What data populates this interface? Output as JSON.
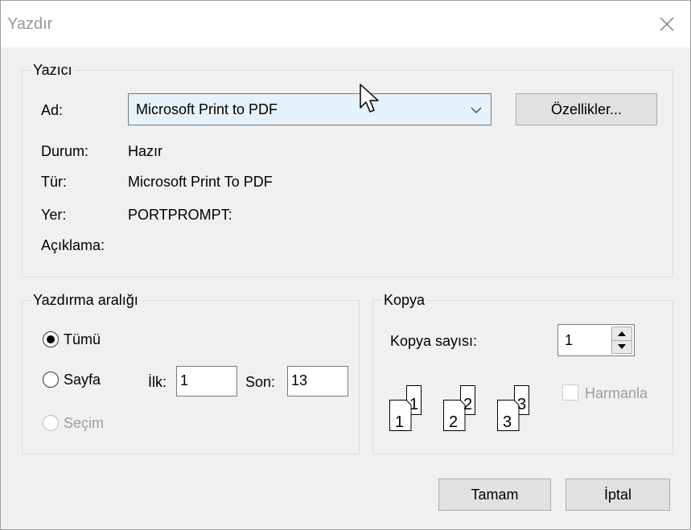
{
  "window": {
    "title": "Yazdır"
  },
  "printer": {
    "group_title": "Yazıcı",
    "name_label": "Ad:",
    "name_value": "Microsoft Print to PDF",
    "properties_button": "Özellikler...",
    "status_label": "Durum:",
    "status_value": "Hazır",
    "type_label": "Tür:",
    "type_value": "Microsoft Print To PDF",
    "location_label": "Yer:",
    "location_value": "PORTPROMPT:",
    "comment_label": "Açıklama:",
    "comment_value": ""
  },
  "print_range": {
    "group_title": "Yazdırma aralığı",
    "all_label": "Tümü",
    "all_checked": true,
    "pages_label": "Sayfa",
    "from_label": "İlk:",
    "from_value": "1",
    "to_label": "Son:",
    "to_value": "13",
    "selection_label": "Seçim",
    "selection_enabled": false
  },
  "copies": {
    "group_title": "Kopya",
    "count_label": "Kopya sayısı:",
    "count_value": "1",
    "collate_label": "Harmanla",
    "collate_checked": false,
    "collate_enabled": false,
    "illustration_numbers": [
      "1",
      "1",
      "2",
      "2",
      "3",
      "3"
    ]
  },
  "buttons": {
    "ok": "Tamam",
    "cancel": "İptal"
  },
  "icons": {
    "close": "close-icon",
    "dropdown": "chevron-down-icon",
    "spin_up": "spin-up-icon",
    "spin_down": "spin-down-icon",
    "cursor": "mouse-pointer-icon"
  }
}
